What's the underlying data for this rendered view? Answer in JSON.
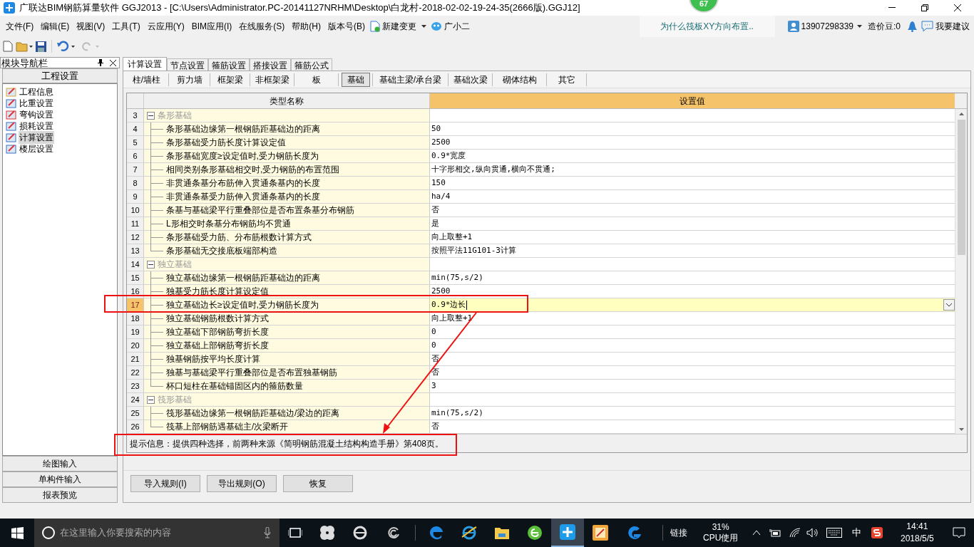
{
  "window": {
    "title": "广联达BIM钢筋算量软件 GGJ2013 - [C:\\Users\\Administrator.PC-20141127NRHM\\Desktop\\白龙村-2018-02-02-19-24-35(2666版).GGJ12]",
    "badge": "67"
  },
  "menu": [
    "文件(F)",
    "编辑(E)",
    "视图(V)",
    "工具(T)",
    "云应用(Y)",
    "BIM应用(I)",
    "在线服务(S)",
    "帮助(H)",
    "版本号(B)"
  ],
  "menu_extras": [
    {
      "kind": "change",
      "label": "新建变更"
    },
    {
      "kind": "bot",
      "label": "广小二"
    }
  ],
  "news": "为什么筏板XY方向布置..",
  "account": {
    "phone": "13907298339",
    "beans": "造价豆:0",
    "suggest": "我要建议"
  },
  "nav": {
    "title": "模块导航栏",
    "section": "工程设置",
    "items": [
      {
        "label": "工程信息",
        "selected": false
      },
      {
        "label": "比重设置",
        "selected": false
      },
      {
        "label": "弯钩设置",
        "selected": false
      },
      {
        "label": "损耗设置",
        "selected": false
      },
      {
        "label": "计算设置",
        "selected": true
      },
      {
        "label": "楼层设置",
        "selected": false
      }
    ],
    "bottom": [
      "绘图输入",
      "单构件输入",
      "报表预览"
    ]
  },
  "tabs": [
    {
      "label": "计算设置",
      "selected": true
    },
    {
      "label": "节点设置",
      "selected": false
    },
    {
      "label": "箍筋设置",
      "selected": false
    },
    {
      "label": "搭接设置",
      "selected": false
    },
    {
      "label": "箍筋公式",
      "selected": false
    }
  ],
  "subtabs": [
    {
      "label": "柱/墙柱",
      "selected": false
    },
    {
      "label": "剪力墙",
      "selected": false
    },
    {
      "label": "框架梁",
      "selected": false
    },
    {
      "label": "非框架梁",
      "selected": false
    },
    {
      "label": "板",
      "selected": false
    },
    {
      "label": "基础",
      "selected": true
    },
    {
      "label": "基础主梁/承台梁",
      "selected": false
    },
    {
      "label": "基础次梁",
      "selected": false
    },
    {
      "label": "砌体结构",
      "selected": false
    },
    {
      "label": "其它",
      "selected": false
    }
  ],
  "table": {
    "columns": [
      "类型名称",
      "设置值"
    ],
    "rows": [
      {
        "kind": "group",
        "num": "3",
        "name": "条形基础",
        "expanded": true
      },
      {
        "kind": "item",
        "num": "4",
        "name": "条形基础边缘第一根钢筋距基础边的距离",
        "value": "50",
        "selected": false
      },
      {
        "kind": "item",
        "num": "5",
        "name": "条形基础受力筋长度计算设定值",
        "value": "2500",
        "selected": false
      },
      {
        "kind": "item",
        "num": "6",
        "name": "条形基础宽度≥设定值时,受力钢筋长度为",
        "value": "0.9*宽度",
        "selected": false
      },
      {
        "kind": "item",
        "num": "7",
        "name": "相同类别条形基础相交时,受力钢筋的布置范围",
        "value": "十字形相交,纵向贯通,横向不贯通;",
        "selected": false
      },
      {
        "kind": "item",
        "num": "8",
        "name": "非贯通条基分布筋伸入贯通条基内的长度",
        "value": "150",
        "selected": false
      },
      {
        "kind": "item",
        "num": "9",
        "name": "非贯通条基受力筋伸入贯通条基内的长度",
        "value": "ha/4",
        "selected": false
      },
      {
        "kind": "item",
        "num": "10",
        "name": "条基与基础梁平行重叠部位是否布置条基分布钢筋",
        "value": "否",
        "selected": false
      },
      {
        "kind": "item",
        "num": "11",
        "name": "L形相交时条基分布钢筋均不贯通",
        "value": "是",
        "selected": false
      },
      {
        "kind": "item",
        "num": "12",
        "name": "条形基础受力筋、分布筋根数计算方式",
        "value": "向上取整+1",
        "selected": false
      },
      {
        "kind": "item",
        "num": "13",
        "name": "条形基础无交接底板端部构造",
        "value": "按照平法11G101-3计算",
        "selected": false
      },
      {
        "kind": "group",
        "num": "14",
        "name": "独立基础",
        "expanded": true
      },
      {
        "kind": "item",
        "num": "15",
        "name": "独立基础边缘第一根钢筋距基础边的距离",
        "value": "min(75,s/2)",
        "selected": false
      },
      {
        "kind": "item",
        "num": "16",
        "name": "独基受力筋长度计算设定值",
        "value": "2500",
        "selected": false
      },
      {
        "kind": "item",
        "num": "17",
        "name": "独立基础边长≥设定值时,受力钢筋长度为",
        "value": "0.9*边长",
        "selected": true
      },
      {
        "kind": "item",
        "num": "18",
        "name": "独立基础钢筋根数计算方式",
        "value": "向上取整+1",
        "selected": false
      },
      {
        "kind": "item",
        "num": "19",
        "name": "独立基础下部钢筋弯折长度",
        "value": "0",
        "selected": false
      },
      {
        "kind": "item",
        "num": "20",
        "name": "独立基础上部钢筋弯折长度",
        "value": "0",
        "selected": false
      },
      {
        "kind": "item",
        "num": "21",
        "name": "独基钢筋按平均长度计算",
        "value": "否",
        "selected": false
      },
      {
        "kind": "item",
        "num": "22",
        "name": "独基与基础梁平行重叠部位是否布置独基钢筋",
        "value": "否",
        "selected": false
      },
      {
        "kind": "item",
        "num": "23",
        "name": "杯口短柱在基础锚固区内的箍筋数量",
        "value": "3",
        "selected": false
      },
      {
        "kind": "group",
        "num": "24",
        "name": "筏形基础",
        "expanded": true
      },
      {
        "kind": "item",
        "num": "25",
        "name": "筏形基础边缘第一根钢筋距基础边/梁边的距离",
        "value": "min(75,s/2)",
        "selected": false
      },
      {
        "kind": "item",
        "num": "26",
        "name": "筏基上部钢筋遇基础主/次梁断开",
        "value": "否",
        "selected": false
      }
    ]
  },
  "hint": "提示信息：提供四种选择，前两种来源《简明钢筋混凝土结构构造手册》第408页。",
  "buttons": [
    "导入规则(I)",
    "导出规则(O)",
    "恢复"
  ],
  "taskbar": {
    "search_placeholder": "在这里输入你要搜索的内容",
    "links": "链接",
    "cpu": "31%",
    "cpu_label": "CPU使用",
    "ime": "中",
    "time": "14:41",
    "date": "2018/5/5"
  }
}
